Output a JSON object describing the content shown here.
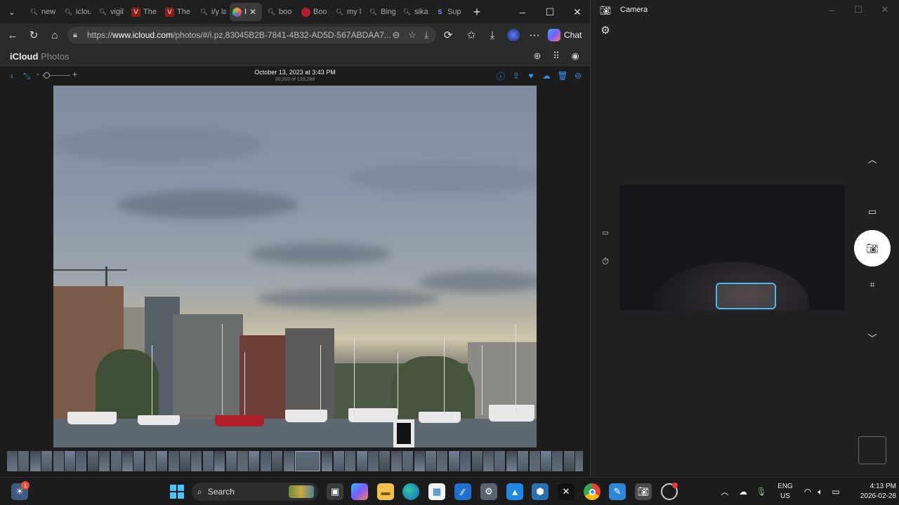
{
  "browser": {
    "tabs": [
      {
        "label": "new",
        "icon": "search-icon"
      },
      {
        "label": "iclou",
        "icon": "search-icon"
      },
      {
        "label": "vigil",
        "icon": "search-icon"
      },
      {
        "label": "The",
        "icon": "site-icon"
      },
      {
        "label": "The",
        "icon": "site-icon"
      },
      {
        "label": "i/y la",
        "icon": "search-icon"
      },
      {
        "label": "I",
        "icon": "icloud-photos-icon",
        "active": true
      },
      {
        "label": "boo",
        "icon": "search-icon"
      },
      {
        "label": "Boo",
        "icon": "site-icon"
      },
      {
        "label": "my l",
        "icon": "search-icon"
      },
      {
        "label": "Bing",
        "icon": "search-icon"
      },
      {
        "label": "sika",
        "icon": "search-icon"
      },
      {
        "label": "Sup",
        "icon": "site-icon"
      }
    ],
    "url_prefix": "https://",
    "url_domain": "www.icloud.com",
    "url_rest": "/photos/#/i.pz,83045B2B-7841-4B32-AD5D-567ABDAA7...",
    "chat_label": "Chat"
  },
  "icloud": {
    "brand": "iCloud",
    "section": "Photos",
    "photo_date": "October 13, 2023 at 3:43 PM",
    "photo_count": "30,203 of 139,288"
  },
  "camera": {
    "title": "Camera"
  },
  "taskbar": {
    "search_label": "Search",
    "notification_count": "1",
    "lang_top": "ENG",
    "lang_bottom": "US",
    "time": "4:13 PM",
    "date": "2026-02-28"
  },
  "colors": {
    "accent_blue": "#3b8ef0",
    "face_box": "#47b8f0"
  }
}
